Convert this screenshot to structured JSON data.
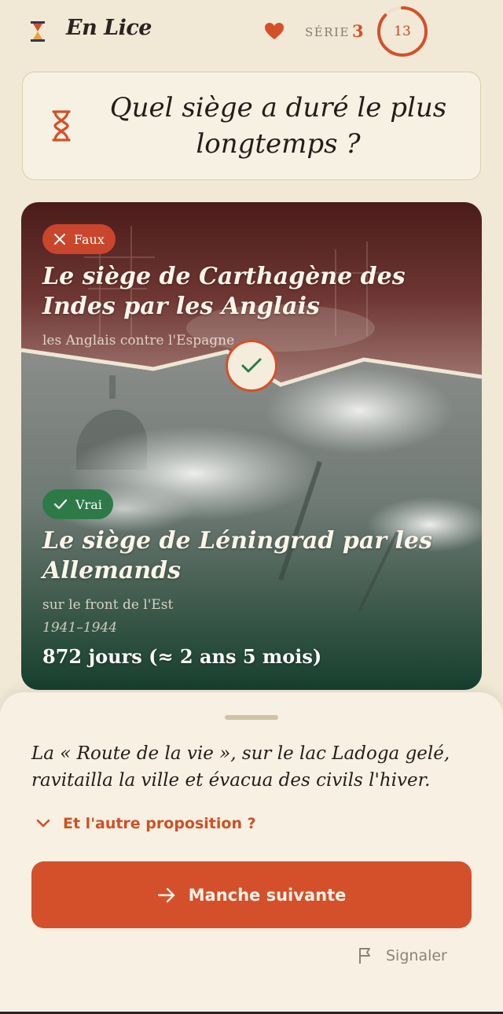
{
  "header": {
    "app_title": "En Lice",
    "series_label": "SÉRIE",
    "series_count": "3",
    "timer_value": "13",
    "timer_fraction": 0.87
  },
  "question": {
    "text": "Quel siège a duré le plus longtemps ?"
  },
  "options": [
    {
      "verdict": "Faux",
      "title": "Le siège de Carthagène des Indes par les Anglais",
      "subtitle": "les Anglais contre l'Espagne"
    },
    {
      "verdict": "Vrai",
      "title": "Le siège de Léningrad par les Allemands",
      "subtitle": "sur le front de l'Est",
      "years": "1941–1944",
      "value": "872 jours (≈ 2 ans 5 mois)"
    }
  ],
  "sheet": {
    "fact": "La « Route de la vie », sur le lac Ladoga gelé, ravitailla la ville et évacua des civils l'hiver.",
    "other_toggle": "Et l'autre proposition ?",
    "next_button": "Manche suivante",
    "report": "Signaler"
  },
  "colors": {
    "accent": "#d4502a",
    "wrong": "#c9452b",
    "right": "#2d7a48",
    "background": "#f1e8d6"
  }
}
